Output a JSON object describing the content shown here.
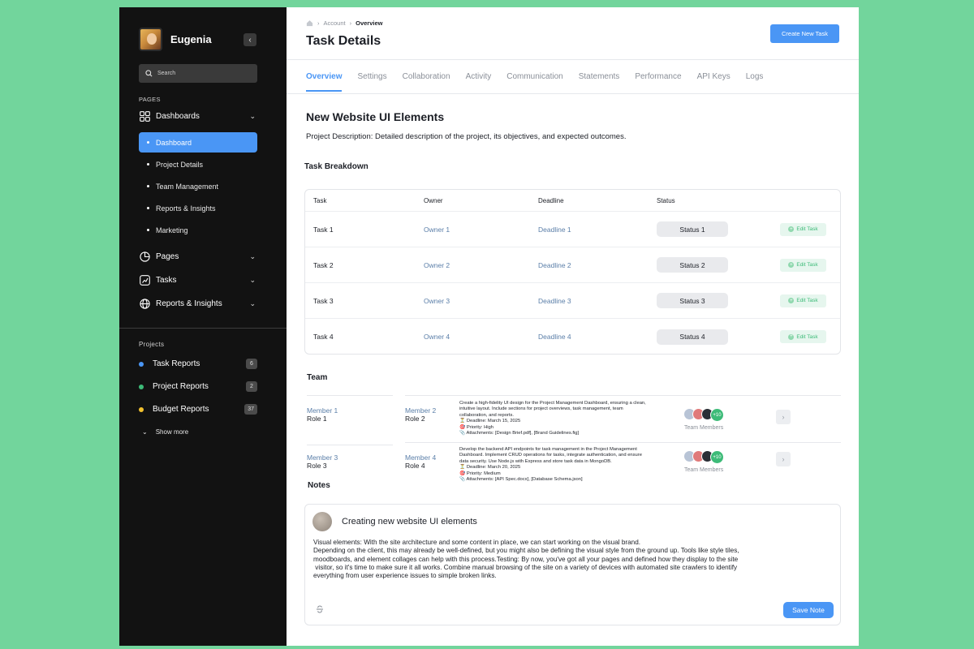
{
  "sidebar": {
    "user_name": "Eugenia",
    "search_placeholder": "Search",
    "pages_label": "PAGES",
    "groups": [
      {
        "label": "Dashboards",
        "icon": "grid-icon"
      },
      {
        "label": "Pages",
        "icon": "pie-icon"
      },
      {
        "label": "Tasks",
        "icon": "chart-icon"
      },
      {
        "label": "Reports & Insights",
        "icon": "globe-icon"
      }
    ],
    "dashboard_items": [
      "Dashboard",
      "Project Details",
      "Team Management",
      "Reports & Insights",
      "Marketing"
    ],
    "active_item": "Dashboard",
    "projects_label": "Projects",
    "projects": [
      {
        "label": "Task Reports",
        "count": "6",
        "color": "#4a96f5"
      },
      {
        "label": "Project Reports",
        "count": "2",
        "color": "#3dbb78"
      },
      {
        "label": "Budget Reports",
        "count": "37",
        "color": "#f2c12e"
      }
    ],
    "show_more": "Show more"
  },
  "header": {
    "breadcrumb": [
      "Account",
      "Overview"
    ],
    "title": "Task Details",
    "create_button": "Create New Task"
  },
  "tabs": [
    "Overview",
    "Settings",
    "Collaboration",
    "Activity",
    "Communication",
    "Statements",
    "Performance",
    "API Keys",
    "Logs"
  ],
  "active_tab": "Overview",
  "project": {
    "title": "New Website UI Elements",
    "description": "Project Description: Detailed description of the project, its objectives, and expected outcomes."
  },
  "task_breakdown": {
    "heading": "Task Breakdown",
    "columns": [
      "Task",
      "Owner",
      "Deadline",
      "Status"
    ],
    "rows": [
      {
        "task": "Task 1",
        "owner": "Owner 1",
        "deadline": "Deadline 1",
        "status": "Status 1"
      },
      {
        "task": "Task 2",
        "owner": "Owner 2",
        "deadline": "Deadline 2",
        "status": "Status 2"
      },
      {
        "task": "Task 3",
        "owner": "Owner 3",
        "deadline": "Deadline 3",
        "status": "Status 3"
      },
      {
        "task": "Task 4",
        "owner": "Owner 4",
        "deadline": "Deadline 4",
        "status": "Status 4"
      }
    ],
    "edit_label": "Edit Task"
  },
  "team": {
    "heading": "Team",
    "rows": [
      {
        "member_a": {
          "name": "Member 1",
          "role": "Role 1"
        },
        "member_b": {
          "name": "Member 2",
          "role": "Role 2"
        },
        "desc_lines": [
          "Create a high-fidelity UI design for the Project Management Dashboard, ensuring a clean,",
          "intuitive layout. Include sections for project overviews, task management, team",
          "collaboration, and reports.",
          "⏳ Deadline: March 15, 2025",
          "🎯 Priority: High",
          "📎 Attachments: [Design Brief.pdf], [Brand Guidelines.fig]"
        ],
        "more_count": "+10",
        "members_label": "Team Members"
      },
      {
        "member_a": {
          "name": "Member 3",
          "role": "Role 3"
        },
        "member_b": {
          "name": "Member 4",
          "role": "Role 4"
        },
        "desc_lines": [
          "Develop the backend API endpoints for task management in the Project Management",
          "Dashboard. Implement CRUD operations for tasks, integrate authentication, and ensure",
          "data security. Use Node.js with Express and store task data in MongoDB.",
          "⏳ Deadline: March 20, 2025",
          "🎯 Priority: Medium",
          "📎 Attachments: [API Spec.docx], [Database Schema.json]"
        ],
        "more_count": "+10",
        "members_label": "Team Members"
      }
    ]
  },
  "notes": {
    "heading": "Notes",
    "title": "Creating new website UI elements",
    "body_lines": [
      "Visual elements: With the site architecture and some content in place, we can start working on the visual brand.",
      "Depending on the client, this may already be well-defined, but you might also be defining the visual style from the ground up. Tools like style tiles,",
      "moodboards, and element collages can help with this process.Testing: By now, you've got all your pages and defined how they display to the site",
      " visitor, so it's time to make sure it all works. Combine manual browsing of the site on a variety of devices with automated site crawlers to identify",
      "everything from user experience issues to simple broken links."
    ],
    "save_button": "Save Note"
  },
  "colors": {
    "accent": "#4a96f5",
    "success": "#3dbb78",
    "sidebar_bg": "#121212",
    "page_bg": "#72d59c"
  }
}
